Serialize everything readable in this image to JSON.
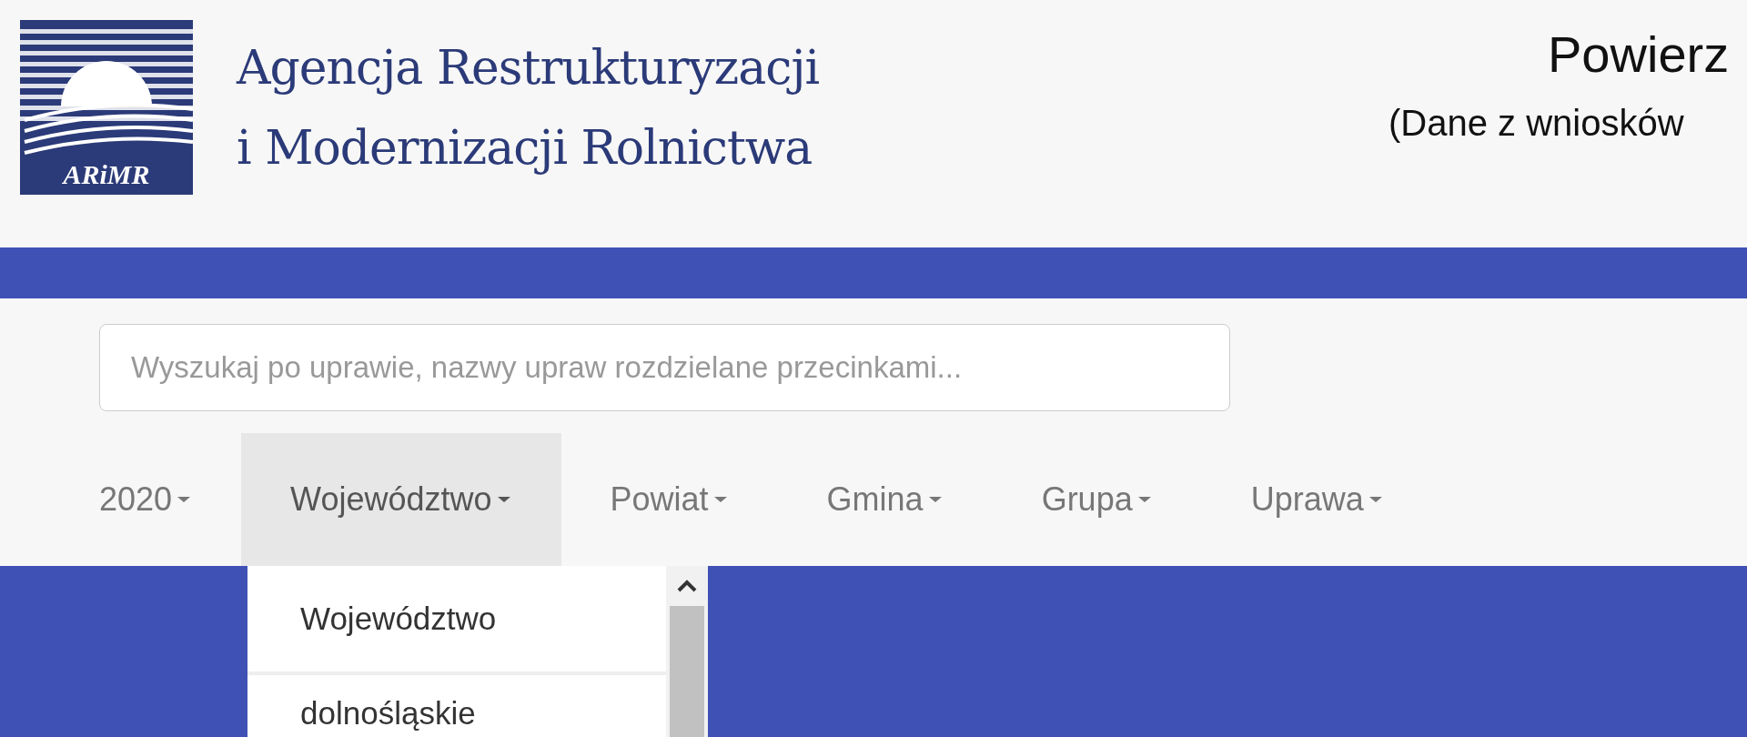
{
  "header": {
    "logo_mark": "ARiMR",
    "agency_name": [
      "Agencja Restrukturyzacji",
      "i Modernizacji Rolnictwa"
    ],
    "title": "Powierz",
    "subtitle": "(Dane z wniosków"
  },
  "search": {
    "placeholder": "Wyszukaj po uprawie, nazwy upraw rozdzielane przecinkami..."
  },
  "nav": [
    {
      "label": "2020",
      "selected": false
    },
    {
      "label": "Województwo",
      "selected": true
    },
    {
      "label": "Powiat",
      "selected": false
    },
    {
      "label": "Gmina",
      "selected": false
    },
    {
      "label": "Grupa",
      "selected": false
    },
    {
      "label": "Uprawa",
      "selected": false
    }
  ],
  "dropdown": {
    "items": [
      "Województwo",
      "dolnośląskie"
    ]
  }
}
